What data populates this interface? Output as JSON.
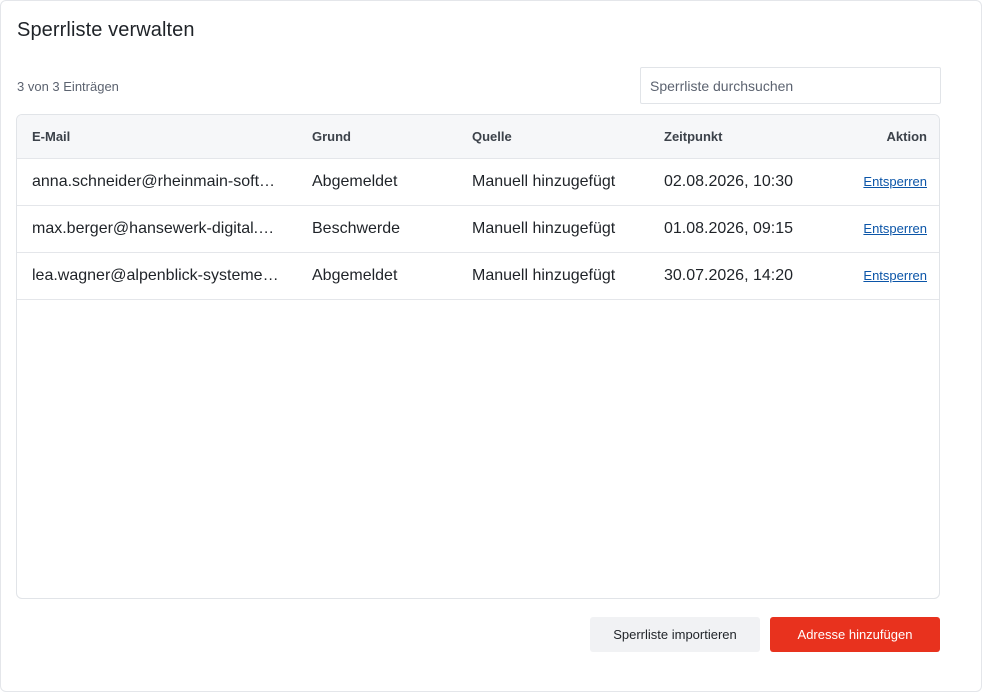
{
  "dialog": {
    "title": "Sperrliste verwalten",
    "count_text": "3 von 3 Einträgen",
    "search": {
      "placeholder": "Sperrliste durchsuchen",
      "value": ""
    }
  },
  "table": {
    "headers": {
      "email": "E-Mail",
      "reason": "Grund",
      "source": "Quelle",
      "time": "Zeitpunkt",
      "action": "Aktion"
    },
    "rows": [
      {
        "email": "anna.schneider@rheinmain-soft…",
        "reason": "Abgemeldet",
        "source": "Manuell hinzugefügt",
        "time": "02.08.2026, 10:30",
        "action": "Entsperren"
      },
      {
        "email": "max.berger@hansewerk-digital.…",
        "reason": "Beschwerde",
        "source": "Manuell hinzugefügt",
        "time": "01.08.2026, 09:15",
        "action": "Entsperren"
      },
      {
        "email": "lea.wagner@alpenblick-systeme…",
        "reason": "Abgemeldet",
        "source": "Manuell hinzugefügt",
        "time": "30.07.2026, 14:20",
        "action": "Entsperren"
      }
    ]
  },
  "footer": {
    "import_label": "Sperrliste importieren",
    "add_label": "Adresse hinzufügen"
  },
  "colors": {
    "primary": "#e8321e",
    "link": "#0b55a8",
    "header_bg": "#f6f7f9"
  }
}
